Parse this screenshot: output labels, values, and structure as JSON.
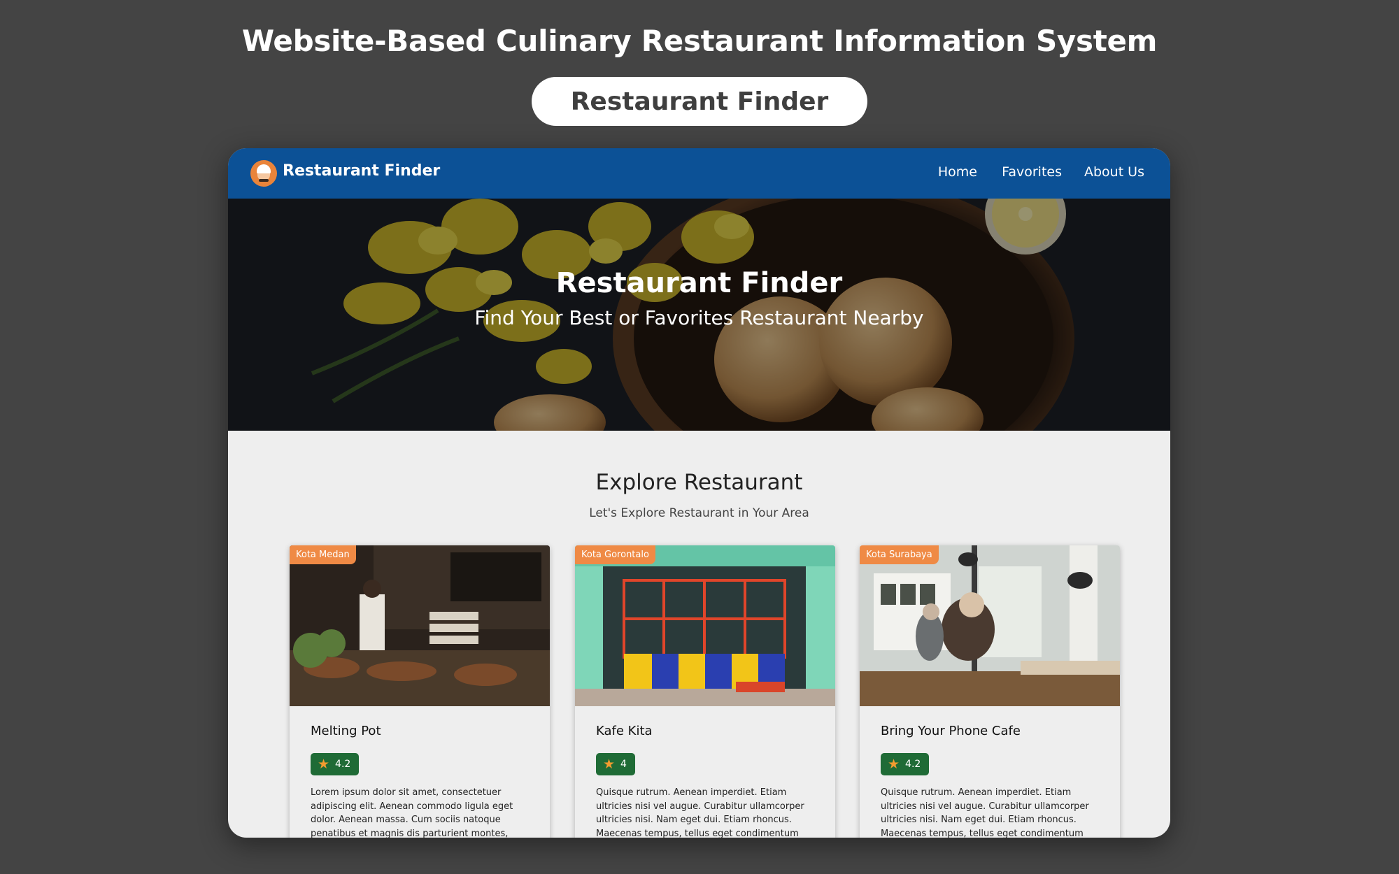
{
  "page_heading": "Website-Based Culinary Restaurant Information System",
  "pill_label": "Restaurant Finder",
  "navbar": {
    "brand": "Restaurant Finder",
    "links": [
      "Home",
      "Favorites",
      "About Us"
    ]
  },
  "hero": {
    "title": "Restaurant Finder",
    "subtitle": "Find Your Best or Favorites Restaurant Nearby"
  },
  "explore": {
    "title": "Explore Restaurant",
    "subtitle": "Let's Explore Restaurant in Your Area"
  },
  "cards": [
    {
      "city": "Kota Medan",
      "name": "Melting Pot",
      "rating": "4.2",
      "description": "Lorem ipsum dolor sit amet, consectetuer adipiscing elit. Aenean commodo ligula eget dolor. Aenean massa. Cum sociis natoque penatibus et magnis dis parturient montes, nascetur ridiculus"
    },
    {
      "city": "Kota Gorontalo",
      "name": "Kafe Kita",
      "rating": "4",
      "description": "Quisque rutrum. Aenean imperdiet. Etiam ultricies nisi vel augue. Curabitur ullamcorper ultricies nisi. Nam eget dui. Etiam rhoncus. Maecenas tempus, tellus eget condimentum rhoncus, sem quam"
    },
    {
      "city": "Kota Surabaya",
      "name": "Bring Your Phone Cafe",
      "rating": "4.2",
      "description": "Quisque rutrum. Aenean imperdiet. Etiam ultricies nisi vel augue. Curabitur ullamcorper ultricies nisi. Nam eget dui. Etiam rhoncus. Maecenas tempus, tellus eget condimentum rhoncus, sem quam"
    }
  ],
  "colors": {
    "background": "#444444",
    "navbar": "#0c5196",
    "city_tag": "#ef8a45",
    "rating_badge": "#1f6b36",
    "star": "#f39c2f"
  },
  "icons": [
    "chef-logo-icon",
    "star-icon"
  ]
}
